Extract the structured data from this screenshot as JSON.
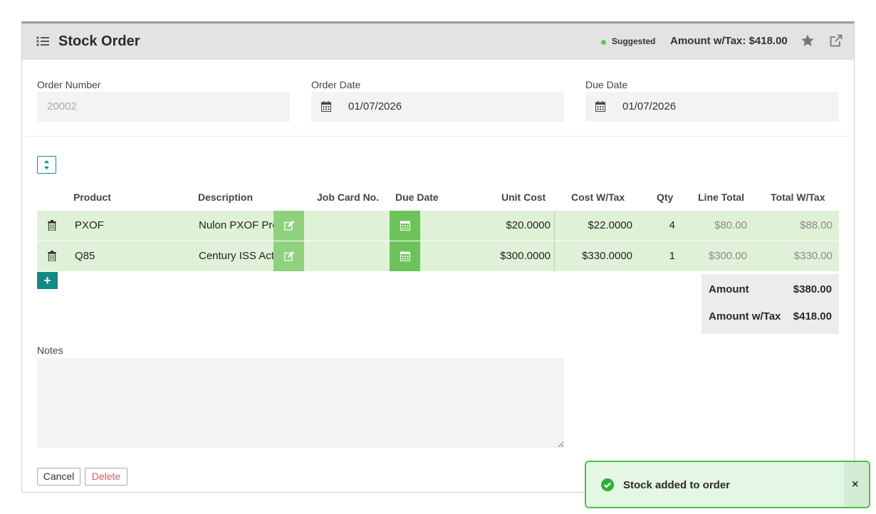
{
  "header": {
    "title": "Stock Order",
    "status": "Suggested",
    "amount_with_tax": "Amount w/Tax: $418.00",
    "status_color": "#5ac85a"
  },
  "fields": {
    "order_number": {
      "label": "Order Number",
      "placeholder": "20002"
    },
    "order_date": {
      "label": "Order Date",
      "value": "01/07/2026"
    },
    "due_date": {
      "label": "Due Date",
      "value": "01/07/2026"
    }
  },
  "table": {
    "headers": {
      "product": "Product",
      "description": "Description",
      "job_card": "Job Card No.",
      "due_date": "Due Date",
      "unit_cost": "Unit Cost",
      "cost_wtax": "Cost W/Tax",
      "qty": "Qty",
      "line_total": "Line Total",
      "total_wtax": "Total W/Tax"
    },
    "rows": [
      {
        "product": "PXOF",
        "description": "Nulon PXOF Pro",
        "job_card": "",
        "unit_cost": "$20.0000",
        "cost_wtax": "$22.0000",
        "qty": "4",
        "line_total": "$80.00",
        "total_wtax": "$88.00"
      },
      {
        "product": "Q85",
        "description": "Century ISS Act",
        "job_card": "",
        "unit_cost": "$300.0000",
        "cost_wtax": "$330.0000",
        "qty": "1",
        "line_total": "$300.00",
        "total_wtax": "$330.00"
      }
    ]
  },
  "totals": {
    "amount_label": "Amount",
    "amount_value": "$380.00",
    "amount_tax_label": "Amount w/Tax",
    "amount_tax_value": "$418.00"
  },
  "notes": {
    "label": "Notes",
    "value": ""
  },
  "actions": {
    "cancel": "Cancel",
    "delete": "Delete"
  },
  "toast": {
    "message": "Stock added to order",
    "close": "×"
  },
  "colors": {
    "row_bg": "#dff2d8",
    "accent": "#138a86",
    "toast_border": "#4cc24c"
  }
}
